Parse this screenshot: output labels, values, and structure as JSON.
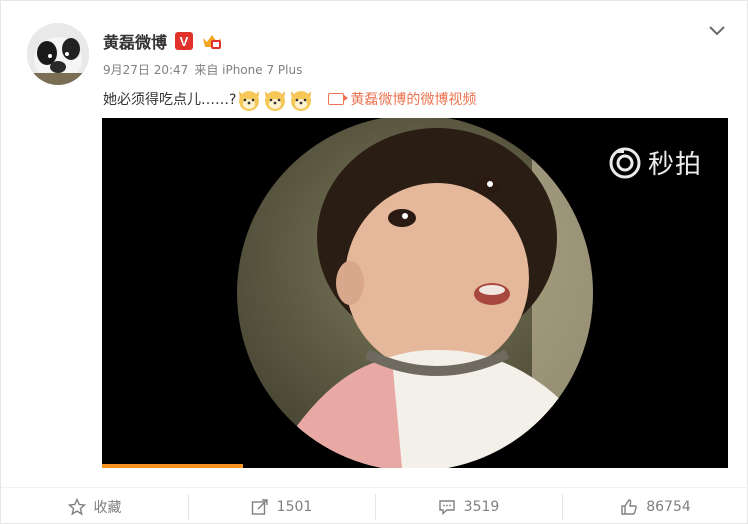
{
  "post": {
    "author": "黄磊微博",
    "verified_badge": "V",
    "timestamp": "9月27日 20:47",
    "source": "来自 iPhone 7 Plus",
    "text": "她必须得吃点儿……?",
    "emoji_count": 3,
    "video_link_label": "黄磊微博的微博视频"
  },
  "video": {
    "watermark": "秒拍",
    "progress": 0.225
  },
  "actions": [
    {
      "label": "收藏",
      "icon": "star-icon"
    },
    {
      "label": "1501",
      "icon": "share-icon"
    },
    {
      "label": "3519",
      "icon": "comment-icon"
    },
    {
      "label": "86754",
      "icon": "like-icon"
    }
  ],
  "colors": {
    "accent": "#eb7350",
    "verified": "#e0322b",
    "progress": "#f7931e"
  }
}
